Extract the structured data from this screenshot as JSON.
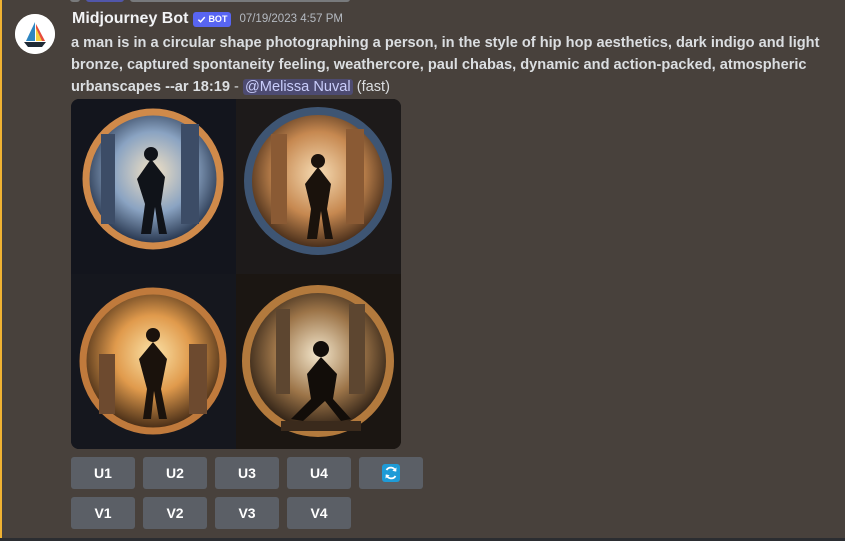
{
  "message": {
    "author": "Midjourney Bot",
    "badge": "BOT",
    "timestamp": "07/19/2023 4:57 PM",
    "prompt": "a man is in a circular shape photographing a person, in the style of hip hop aesthetics, dark indigo and light bronze, captured spontaneity feeling, weathercore, paul chabas, dynamic and action-packed, atmospheric urbanscapes --ar 18:19",
    "separator": " - ",
    "mention": "@Melissa Nuval",
    "speed": "(fast)"
  },
  "image_grid": {
    "description": "2x2 grid of generated images",
    "tiles": [
      "image-1",
      "image-2",
      "image-3",
      "image-4"
    ]
  },
  "actions": {
    "upscale": [
      "U1",
      "U2",
      "U3",
      "U4"
    ],
    "variation": [
      "V1",
      "V2",
      "V3",
      "V4"
    ],
    "reroll_icon": "refresh-icon"
  },
  "colors": {
    "background": "#48413c",
    "button": "#5b5f66",
    "badge": "#5865f2",
    "mention_text": "#c9cdfb",
    "reroll_icon": "#1e9bd7"
  }
}
